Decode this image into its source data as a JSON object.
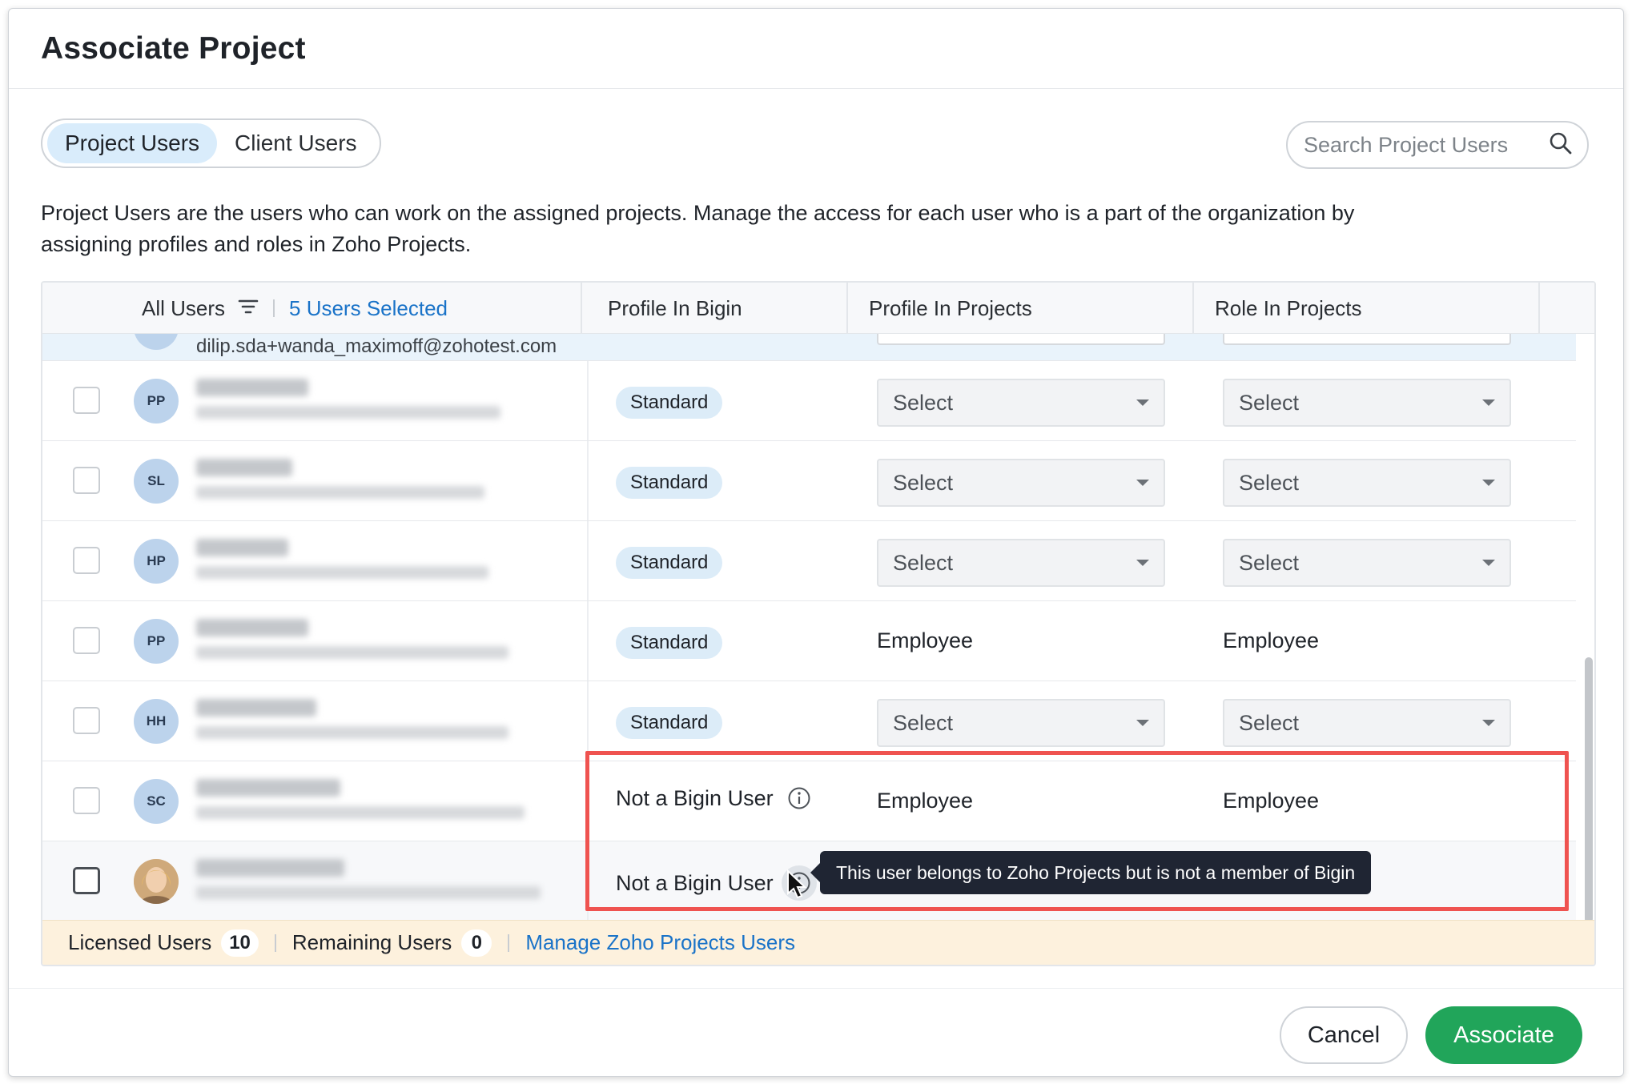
{
  "dialog": {
    "title": "Associate Project"
  },
  "tabs": [
    {
      "label": "Project Users",
      "active": true
    },
    {
      "label": "Client Users",
      "active": false
    }
  ],
  "search": {
    "placeholder": "Search Project Users"
  },
  "description": "Project Users are the users who can work on the assigned projects. Manage the access for each user who is a part of the organization by assigning profiles and roles in Zoho Projects.",
  "table": {
    "headers": {
      "all_users": "All Users",
      "selected": "5 Users Selected",
      "profile_bigin": "Profile In Bigin",
      "profile_projects": "Profile In Projects",
      "role_projects": "Role In Projects"
    },
    "partial_row_email": "dilip.sda+wanda_maximoff@zohotest.com",
    "rows": [
      {
        "initials": "PP",
        "bigin": "Standard",
        "profile": "Select",
        "role": "Select",
        "type": "select"
      },
      {
        "initials": "SL",
        "bigin": "Standard",
        "profile": "Select",
        "role": "Select",
        "type": "select"
      },
      {
        "initials": "HP",
        "bigin": "Standard",
        "profile": "Select",
        "role": "Select",
        "type": "select"
      },
      {
        "initials": "PP",
        "bigin": "Standard",
        "profile": "Employee",
        "role": "Employee",
        "type": "text"
      },
      {
        "initials": "HH",
        "bigin": "Standard",
        "profile": "Select",
        "role": "Select",
        "type": "select"
      },
      {
        "initials": "SC",
        "bigin": "Not a Bigin User",
        "profile": "Employee",
        "role": "Employee",
        "type": "notbigin"
      },
      {
        "initials": "",
        "bigin": "Not a Bigin User",
        "profile": "",
        "role": "",
        "type": "notbigin-hover"
      }
    ]
  },
  "tooltip": "This user belongs to Zoho Projects but is not a member of Bigin",
  "license": {
    "licensed_label": "Licensed Users",
    "licensed_count": "10",
    "remaining_label": "Remaining Users",
    "remaining_count": "0",
    "manage_link": "Manage Zoho Projects Users"
  },
  "buttons": {
    "cancel": "Cancel",
    "associate": "Associate"
  },
  "colors": {
    "accent_blue": "#1a73c8",
    "associate_green": "#21a55a",
    "highlight_red": "#ef5350",
    "tooltip_bg": "#1f2533"
  }
}
